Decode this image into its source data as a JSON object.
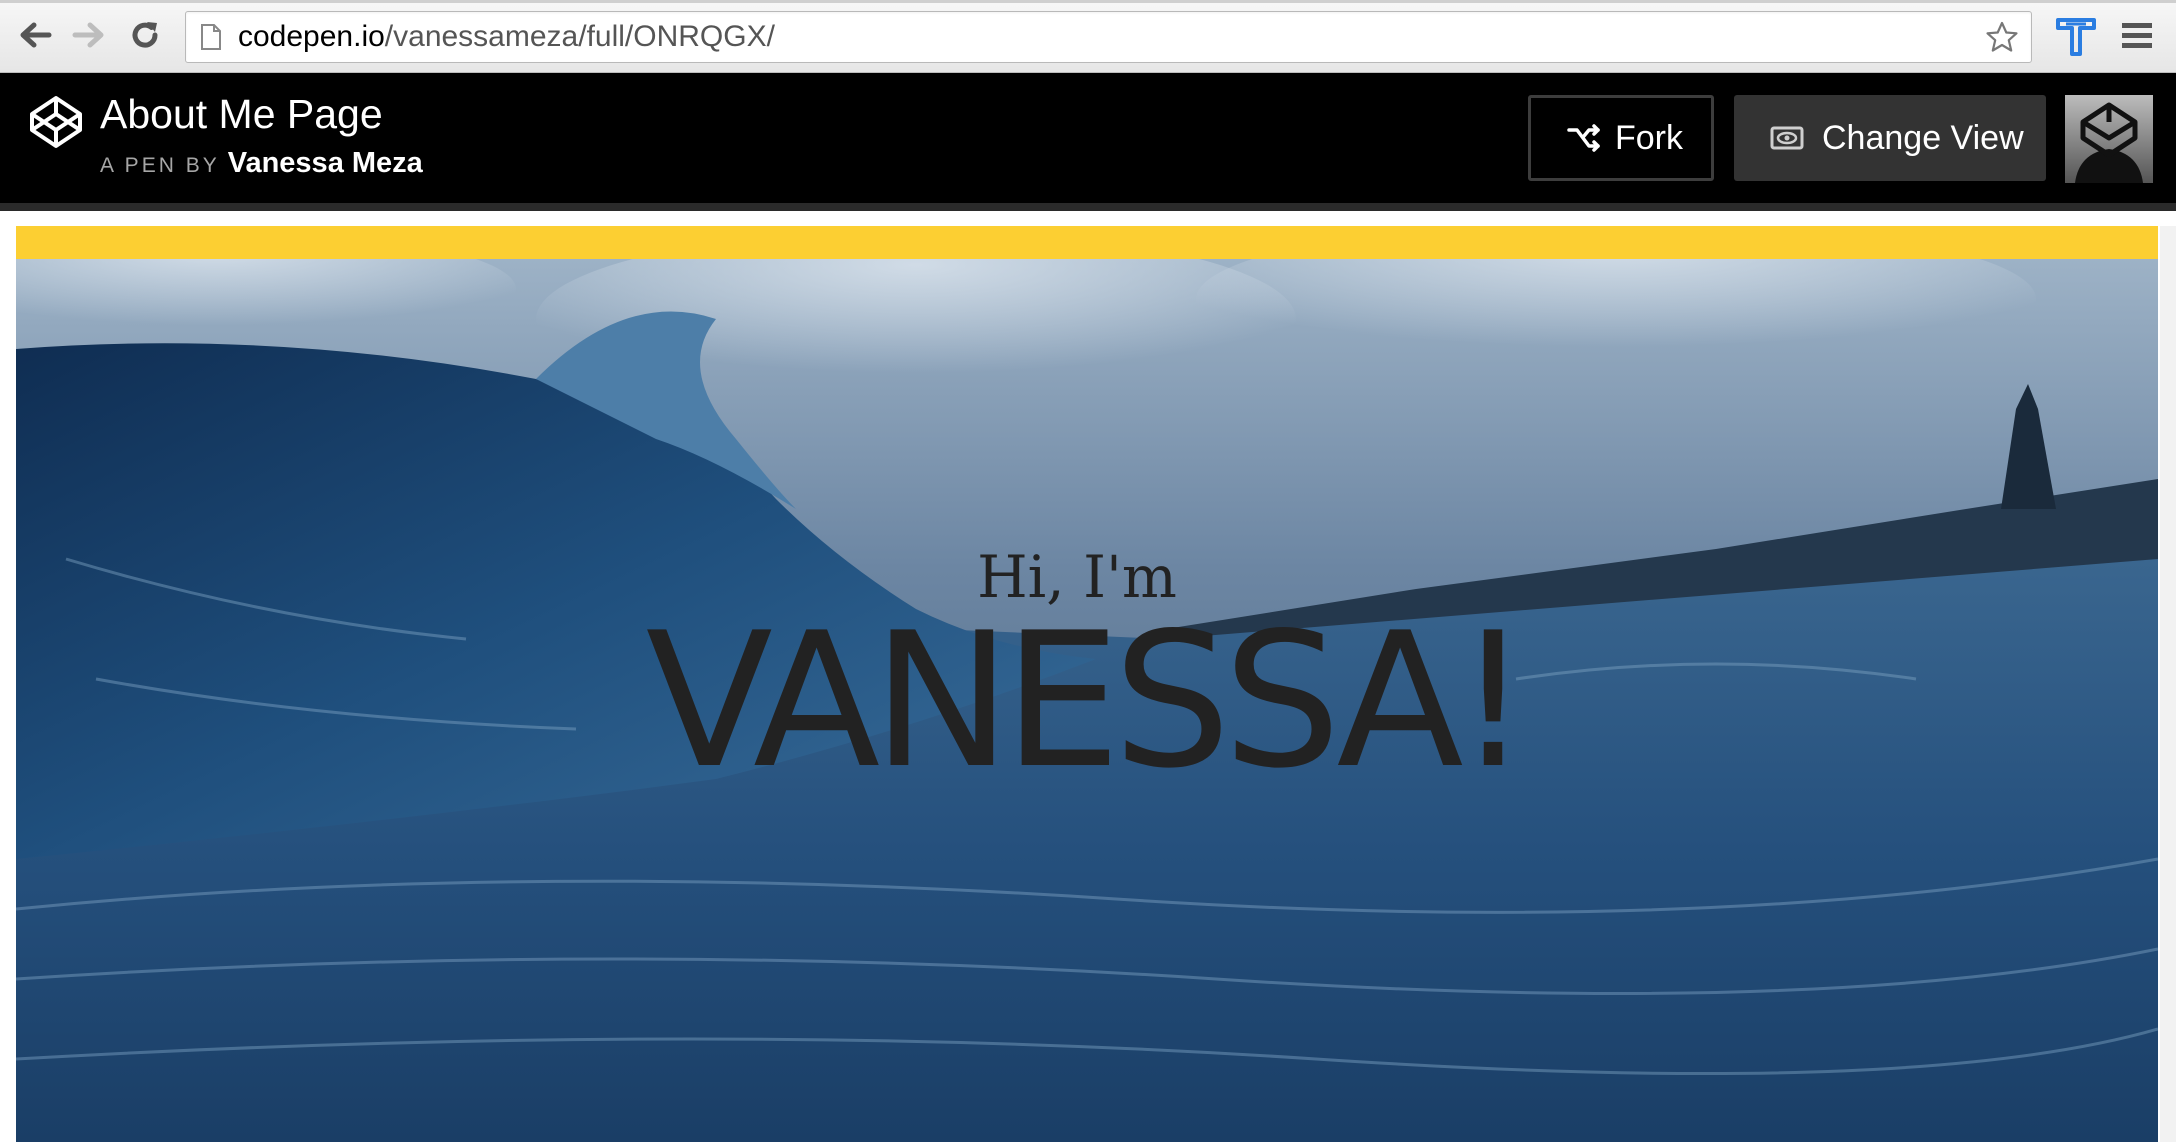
{
  "browser": {
    "url_host": "codepen.io",
    "url_path": "/vanessameza/full/ONRQGX/",
    "icons": [
      "back-arrow-icon",
      "forward-arrow-icon",
      "reload-icon",
      "page-icon",
      "bookmark-star-icon",
      "extension-t-icon",
      "menu-hamburger-icon"
    ]
  },
  "pen_header": {
    "title": "About Me Page",
    "byline_label": "A PEN BY",
    "author": "Vanessa Meza",
    "fork_label": "Fork",
    "change_view_label": "Change View",
    "icons": [
      "codepen-logo-icon",
      "fork-icon",
      "eye-icon",
      "codepen-avatar-icon"
    ]
  },
  "preview": {
    "accent_bar_color": "#fccf32",
    "greeting": "Hi, I'm",
    "name": "VANESSA!",
    "hero_image": "ocean wave"
  },
  "colors": {
    "header_bg": "#000000",
    "button_dark": "#333333",
    "text_dark": "#222222"
  }
}
